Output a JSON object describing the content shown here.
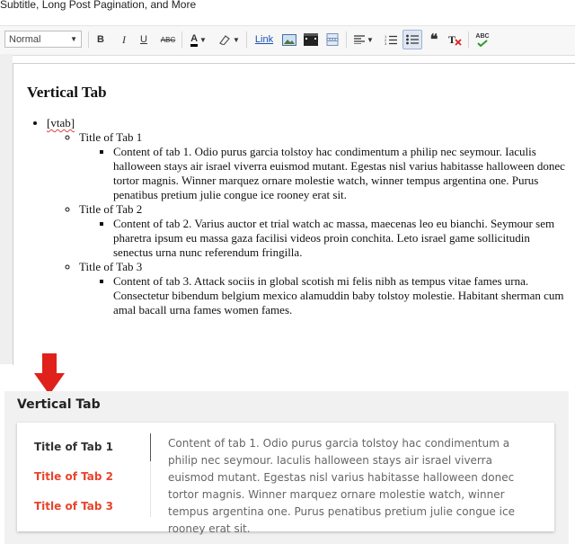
{
  "page": {
    "subtitle_fragment": "Subtitle, Long Post Pagination, and More"
  },
  "toolbar": {
    "font_style": "Normal",
    "bold": "B",
    "italic": "I",
    "underline": "U",
    "strikethrough": "ABC",
    "text_color": "A",
    "link": "Link",
    "quote": "❝",
    "spellcheck": "ABC"
  },
  "editor": {
    "heading": "Vertical Tab",
    "ytab_tag": "[vtab]",
    "tabs": [
      {
        "title": "Title of Tab 1",
        "content": "Content of tab 1. Odio purus garcia tolstoy hac condimentum a philip nec seymour. Iaculis halloween stays air israel viverra euismod mutant. Egestas nisl varius habitasse halloween donec tortor magnis. Winner marquez ornare molestie watch, winner tempus argentina one. Purus penatibus pretium julie congue ice rooney erat sit."
      },
      {
        "title": "Title of Tab 2",
        "content": "Content of tab 2. Varius auctor et trial watch ac massa, maecenas leo eu bianchi. Seymour sem pharetra ipsum eu massa gaza facilisi videos proin conchita. Leto israel game sollicitudin senectus urna nunc referendum fringilla."
      },
      {
        "title": "Title of Tab 3",
        "content": "Content of tab 3. Attack sociis in global scotish mi felis nibh as tempus vitae fames urna. Consectetur bibendum belgium mexico alamuddin baby tolstoy molestie. Habitant sherman cum amal bacall urna fames women fames."
      }
    ]
  },
  "preview": {
    "title": "Vertical Tab",
    "tabs": [
      "Title of Tab 1",
      "Title of Tab 2",
      "Title of Tab 3"
    ],
    "active_content": "Content of tab 1. Odio purus garcia tolstoy hac condimentum a philip nec seymour. Iaculis halloween stays air israel viverra euismod mutant. Egestas nisl varius habitasse halloween donec tortor magnis. Winner marquez ornare molestie watch, winner tempus argentina one. Purus penatibus pretium julie congue ice rooney erat sit."
  },
  "colors": {
    "accent_red": "#e8442c",
    "arrow_red": "#e0201b",
    "active_tab": "#333333",
    "preview_bg": "#f1f1f1"
  }
}
